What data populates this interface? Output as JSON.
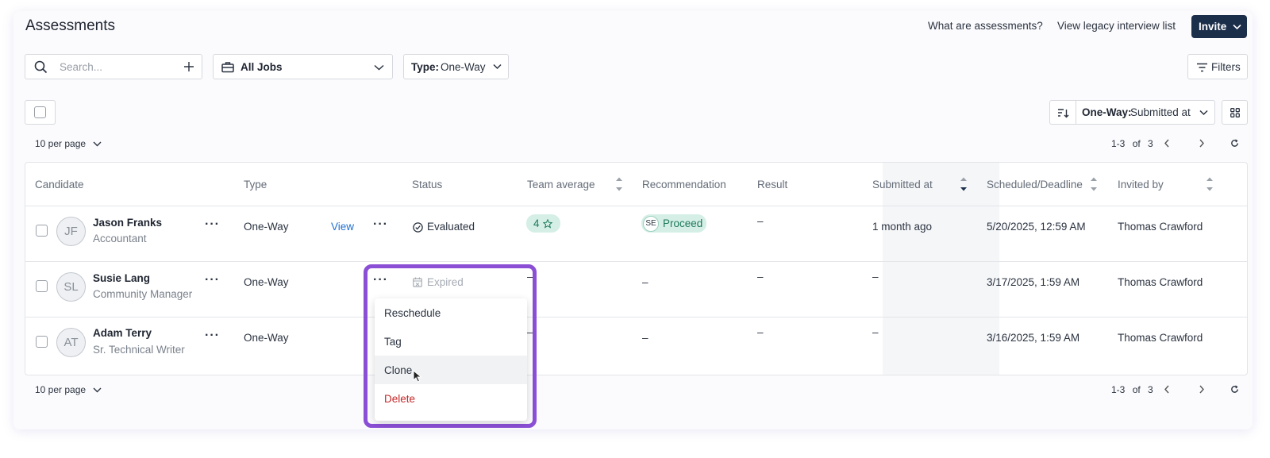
{
  "header": {
    "title": "Assessments",
    "what_link": "What are assessments?",
    "legacy_link": "View legacy interview list",
    "invite_label": "Invite"
  },
  "toolbar": {
    "search_placeholder": "Search...",
    "jobs_label": "All Jobs",
    "type_prefix": "Type:",
    "type_value": "One-Way",
    "filters_label": "Filters",
    "sort_prefix": "One-Way:",
    "sort_value": "Submitted at"
  },
  "pagination": {
    "per_page": "10 per page",
    "range": "1-3",
    "of": "of",
    "total": "3"
  },
  "columns": {
    "candidate": "Candidate",
    "type": "Type",
    "status": "Status",
    "team_average": "Team average",
    "recommendation": "Recommendation",
    "result": "Result",
    "submitted_at": "Submitted at",
    "scheduled": "Scheduled/Deadline",
    "invited_by": "Invited by"
  },
  "rows": [
    {
      "initials": "JF",
      "name": "Jason Franks",
      "role": "Accountant",
      "type": "One-Way",
      "view": "View",
      "status": "Evaluated",
      "team_average": "4",
      "rec_initials": "SE",
      "recommendation": "Proceed",
      "result": "–",
      "submitted": "1 month ago",
      "scheduled": "5/20/2025, 12:59 AM",
      "invited_by": "Thomas Crawford"
    },
    {
      "initials": "SL",
      "name": "Susie Lang",
      "role": "Community Manager",
      "type": "One-Way",
      "status": "Expired",
      "team_average": "–",
      "recommendation": "–",
      "result": "–",
      "submitted": "–",
      "scheduled": "3/17/2025, 1:59 AM",
      "invited_by": "Thomas Crawford"
    },
    {
      "initials": "AT",
      "name": "Adam Terry",
      "role": "Sr. Technical Writer",
      "type": "One-Way",
      "team_average": "–",
      "recommendation": "–",
      "result": "–",
      "submitted": "–",
      "scheduled": "3/16/2025, 1:59 AM",
      "invited_by": "Thomas Crawford"
    }
  ],
  "menu": {
    "items": [
      "Reschedule",
      "Tag",
      "Clone",
      "Delete"
    ]
  },
  "colors": {
    "accent": "#1b2e4a",
    "link": "#1f6fd1",
    "highlight": "#8b4fd6",
    "danger": "#c62828",
    "success_bg": "#d5efe6"
  }
}
